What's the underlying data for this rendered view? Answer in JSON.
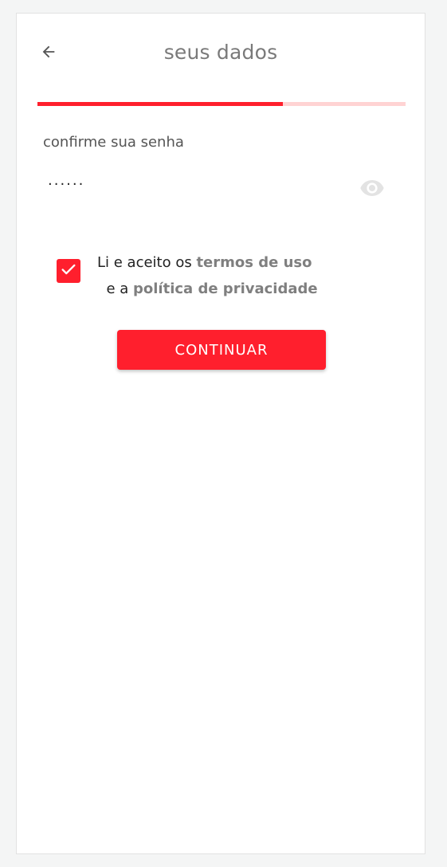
{
  "header": {
    "title": "seus dados",
    "back_icon": "arrow-left-icon"
  },
  "progress": {
    "fraction": 0.667,
    "fill_color": "#ff1f2d",
    "track_color": "#ffd3d3"
  },
  "password_field": {
    "label": "confirme sua senha",
    "value": "······",
    "toggle_icon": "eye-icon"
  },
  "terms": {
    "checked": true,
    "text_prefix": "Li e aceito os ",
    "terms_link": "termos de uso",
    "text_middle": "  e a ",
    "privacy_link": "política de privacidade"
  },
  "actions": {
    "continue_label": "CONTINUAR"
  },
  "colors": {
    "accent": "#ff1f2d",
    "link": "#7f7f7f"
  }
}
